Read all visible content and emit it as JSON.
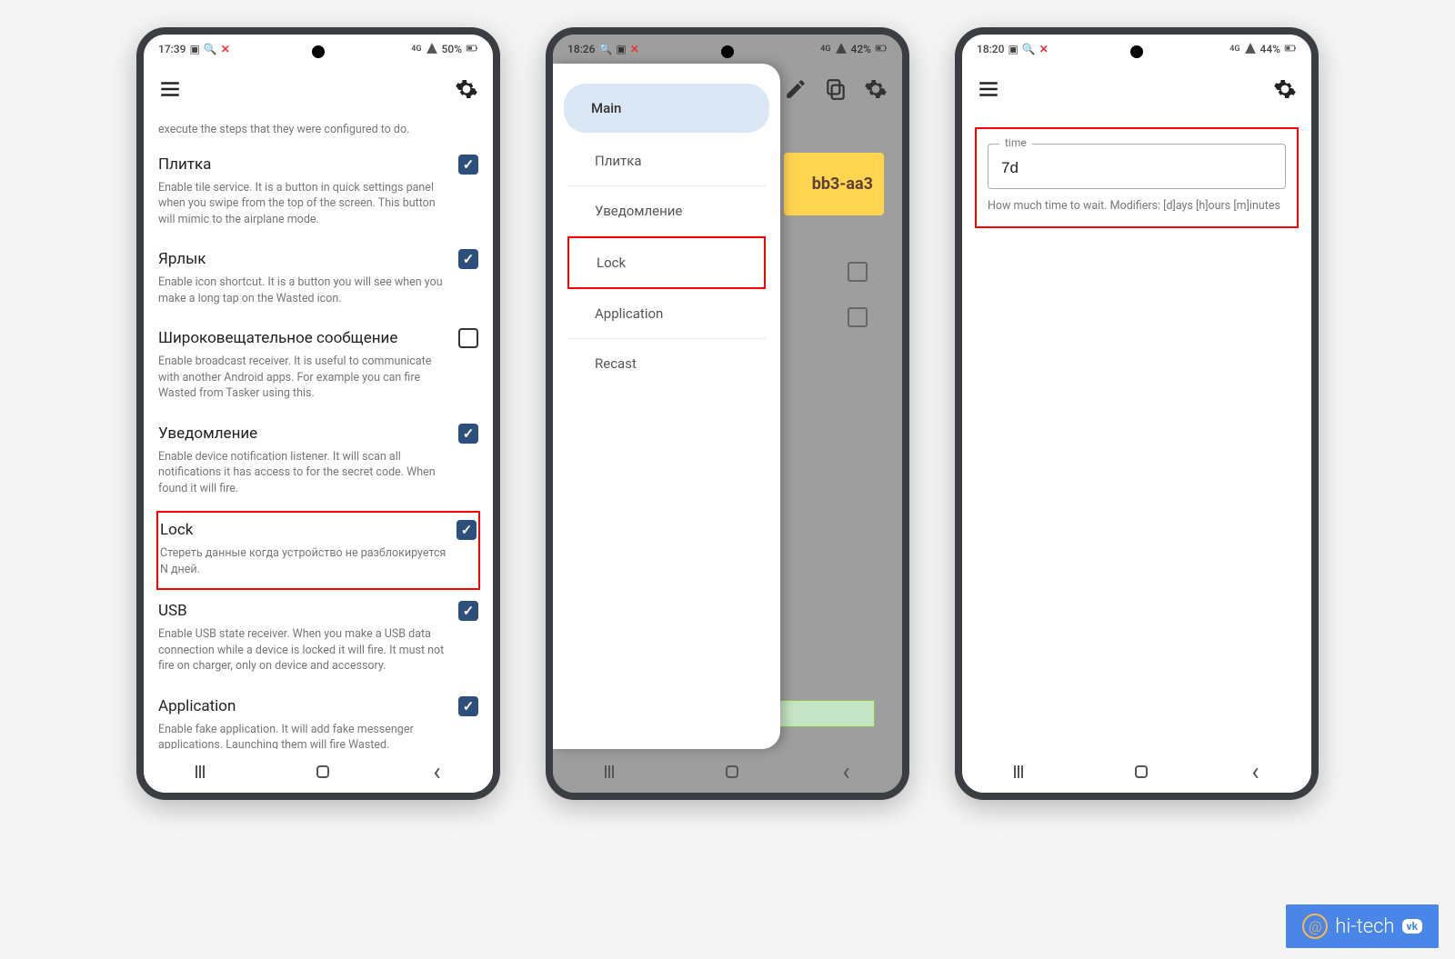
{
  "phone1": {
    "status": {
      "time": "17:39",
      "battery": "50%",
      "net": "4G"
    },
    "cutoff_text": "execute the steps that they were configured to do.",
    "items": [
      {
        "title": "Плитка",
        "desc": "Enable tile service. It is a button in quick settings panel when you swipe from the top of the screen. This button will mimic to the airplane mode.",
        "checked": true,
        "boxed": false
      },
      {
        "title": "Ярлык",
        "desc": "Enable icon shortcut. It is a button you will see when you make a long tap on the Wasted icon.",
        "checked": true,
        "boxed": false
      },
      {
        "title": "Широковещательное сообщение",
        "desc": "Enable broadcast receiver. It is useful to communicate with another Android apps. For example you can fire Wasted from Tasker using this.",
        "checked": false,
        "boxed": false
      },
      {
        "title": "Уведомление",
        "desc": "Enable device notification listener. It will scan all notifications it has access to for the secret code. When found it will fire.",
        "checked": true,
        "boxed": false
      },
      {
        "title": "Lock",
        "desc": "Стереть данные когда устройство не разблокируется N дней.",
        "checked": true,
        "boxed": true
      },
      {
        "title": "USB",
        "desc": "Enable USB state receiver. When you make a USB data connection while a device is locked it will fire. It must not fire on charger, only on device and accessory.",
        "checked": true,
        "boxed": false
      },
      {
        "title": "Application",
        "desc": "Enable fake application. It will add fake messenger applications. Launching them will fire Wasted.",
        "checked": true,
        "boxed": false
      }
    ]
  },
  "phone2": {
    "status": {
      "time": "18:26",
      "battery": "42%",
      "net": "4G"
    },
    "drawer": [
      {
        "label": "Main",
        "active": true,
        "boxed": false
      },
      {
        "label": "Плитка",
        "active": false,
        "boxed": false
      },
      {
        "label": "Уведомление",
        "active": false,
        "boxed": false
      },
      {
        "label": "Lock",
        "active": false,
        "boxed": true
      },
      {
        "label": "Application",
        "active": false,
        "boxed": false
      },
      {
        "label": "Recast",
        "active": false,
        "boxed": false
      }
    ],
    "bg_card_text": "bb3-aa3"
  },
  "phone3": {
    "status": {
      "time": "18:20",
      "battery": "44%",
      "net": "4G"
    },
    "field": {
      "legend": "time",
      "value": "7d",
      "helper": "How much time to wait. Modifiers: [d]ays [h]ours [m]inutes"
    }
  },
  "watermark": {
    "text": "hi-tech",
    "badge": "vk"
  }
}
